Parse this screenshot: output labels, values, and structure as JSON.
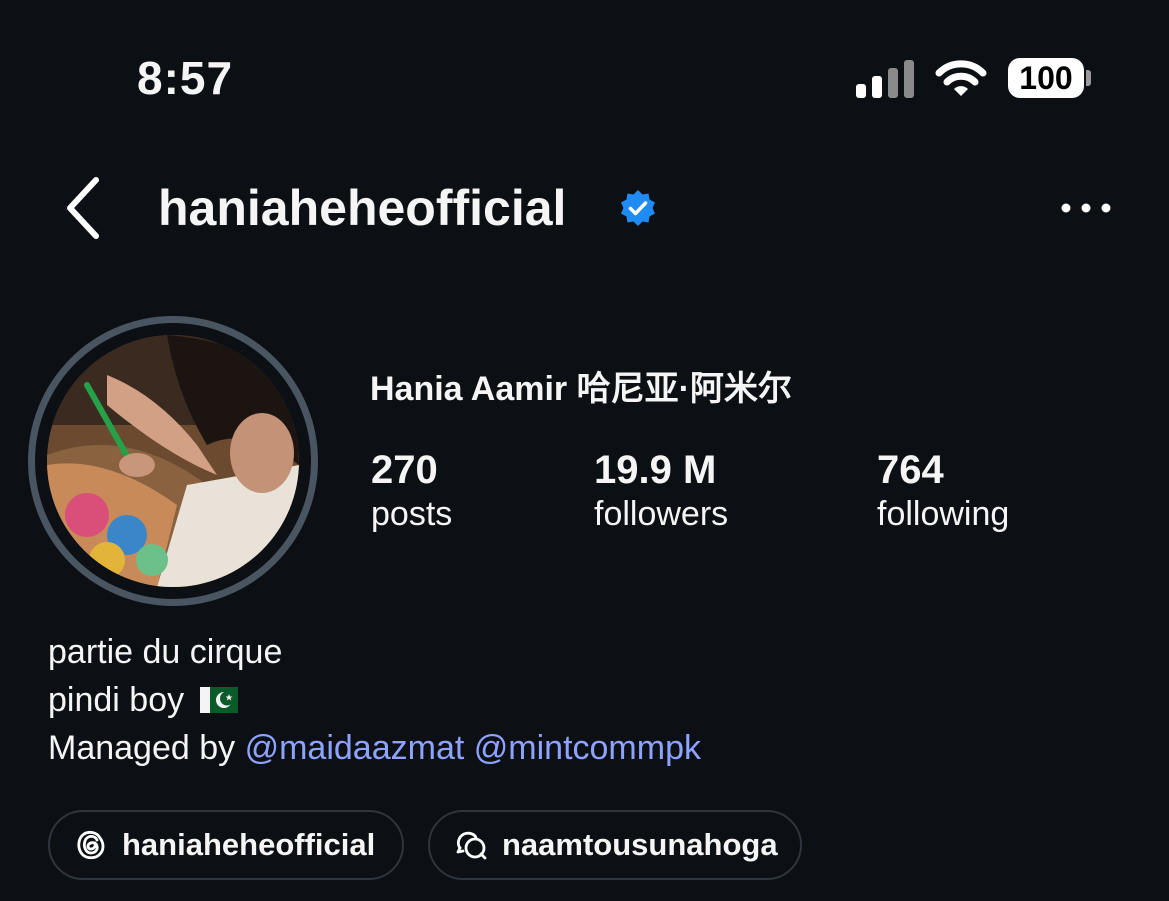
{
  "status_bar": {
    "time": "8:57",
    "battery": "100"
  },
  "header": {
    "username": "haniaheheofficial",
    "back_icon": "chevron-left-icon",
    "more_icon": "ellipsis-icon",
    "verified_icon": "verified-badge-icon"
  },
  "profile": {
    "display_name": "Hania Aamir 哈尼亚·阿米尔",
    "stats": [
      {
        "value": "270",
        "label": "posts"
      },
      {
        "value": "19.9 M",
        "label": "followers"
      },
      {
        "value": "764",
        "label": "following"
      }
    ]
  },
  "bio": {
    "line1": "partie du cirque",
    "line2": "pindi boy",
    "line2_emoji": "pakistan-flag-icon",
    "line3_prefix": "Managed by ",
    "mention1": "@maidaazmat",
    "mention2": "@mintcommpk"
  },
  "links": [
    {
      "icon": "threads-icon",
      "label": "haniaheheofficial"
    },
    {
      "icon": "chat-bubbles-icon",
      "label": "naamtousunahoga"
    }
  ],
  "colors": {
    "background": "#0c1014",
    "mention": "#8ea2ff",
    "verified": "#1f8bf3",
    "avatar_ring": "#495561"
  }
}
